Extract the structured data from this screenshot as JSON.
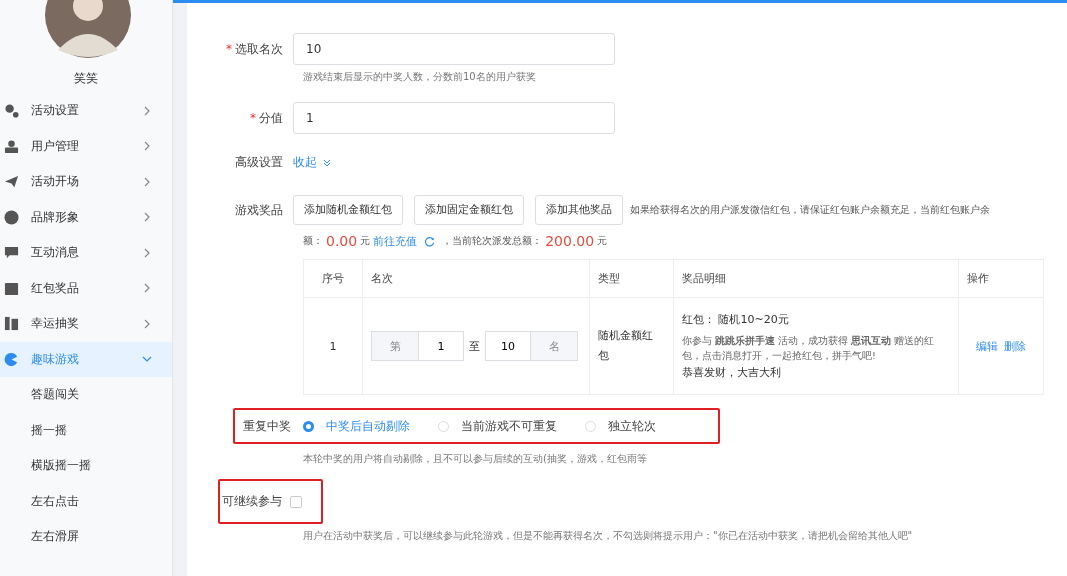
{
  "sidebar": {
    "user_name": "笑笑",
    "items": [
      {
        "label": "活动设置",
        "expanded": false,
        "selected": false
      },
      {
        "label": "用户管理",
        "expanded": false,
        "selected": false
      },
      {
        "label": "活动开场",
        "expanded": false,
        "selected": false
      },
      {
        "label": "品牌形象",
        "expanded": false,
        "selected": false
      },
      {
        "label": "互动消息",
        "expanded": false,
        "selected": false
      },
      {
        "label": "红包奖品",
        "expanded": false,
        "selected": false
      },
      {
        "label": "幸运抽奖",
        "expanded": false,
        "selected": false
      },
      {
        "label": "趣味游戏",
        "expanded": true,
        "selected": true,
        "children": [
          {
            "label": "答题闯关"
          },
          {
            "label": "摇一摇"
          },
          {
            "label": "横版摇一摇"
          },
          {
            "label": "左右点击"
          },
          {
            "label": "左右滑屏"
          }
        ]
      }
    ]
  },
  "form": {
    "rank_field": {
      "label": "选取名次",
      "required_mark": "*",
      "value": "10",
      "hint": "游戏结束后显示的中奖人数，分数前10名的用户获奖"
    },
    "score_field": {
      "label": "分值",
      "required_mark": "*",
      "value": "1"
    },
    "advanced": {
      "label": "高级设置",
      "toggle": "收起"
    },
    "prizes": {
      "label": "游戏奖品",
      "buttons": [
        "添加随机金额红包",
        "添加固定金额红包",
        "添加其他奖品"
      ],
      "note": "如果给获得名次的用户派发微信红包，请保证红包账户余额充足，当前红包账户余",
      "balance_label": "额：",
      "balance": "0.00",
      "unit": "元",
      "recharge": "前往充值",
      "total_label": "，当前轮次派发总额：",
      "total": "200.00",
      "total_unit": "元"
    },
    "table": {
      "columns": [
        "序号",
        "名次",
        "类型",
        "奖品明细",
        "操作"
      ],
      "rows": [
        {
          "index": "1",
          "rank_prefix": "第",
          "rank_from": "1",
          "rank_sep": "至",
          "rank_to": "10",
          "rank_suffix": "名",
          "type": "随机金额红包",
          "detail_title": "红包：  随机10~20元",
          "detail_message": "你参与 **跳跳乐拼手速** 活动，成功获得 **思讯互动** 赠送的红包，点击消息打开，一起抢红包，拼手气吧!",
          "detail_wish": "恭喜发财，大吉大利",
          "actions": [
            "编辑",
            "删除"
          ]
        }
      ]
    },
    "repeat": {
      "label": "重复中奖",
      "highlighted": true,
      "options": [
        {
          "label": "中奖后自动剔除",
          "selected": true
        },
        {
          "label": "当前游戏不可重复",
          "selected": false
        },
        {
          "label": "独立轮次",
          "selected": false
        }
      ],
      "hint": "本轮中奖的用户将自动剔除，且不可以参与后续的互动(抽奖，游戏，红包雨等"
    },
    "continue": {
      "label": "可继续参与",
      "highlighted": true,
      "checked": false,
      "hint": "用户在活动中获奖后，可以继续参与此轮游戏，但是不能再获得名次，不勾选则将提示用户：\"你已在活动中获奖，请把机会留给其他人吧\""
    }
  }
}
